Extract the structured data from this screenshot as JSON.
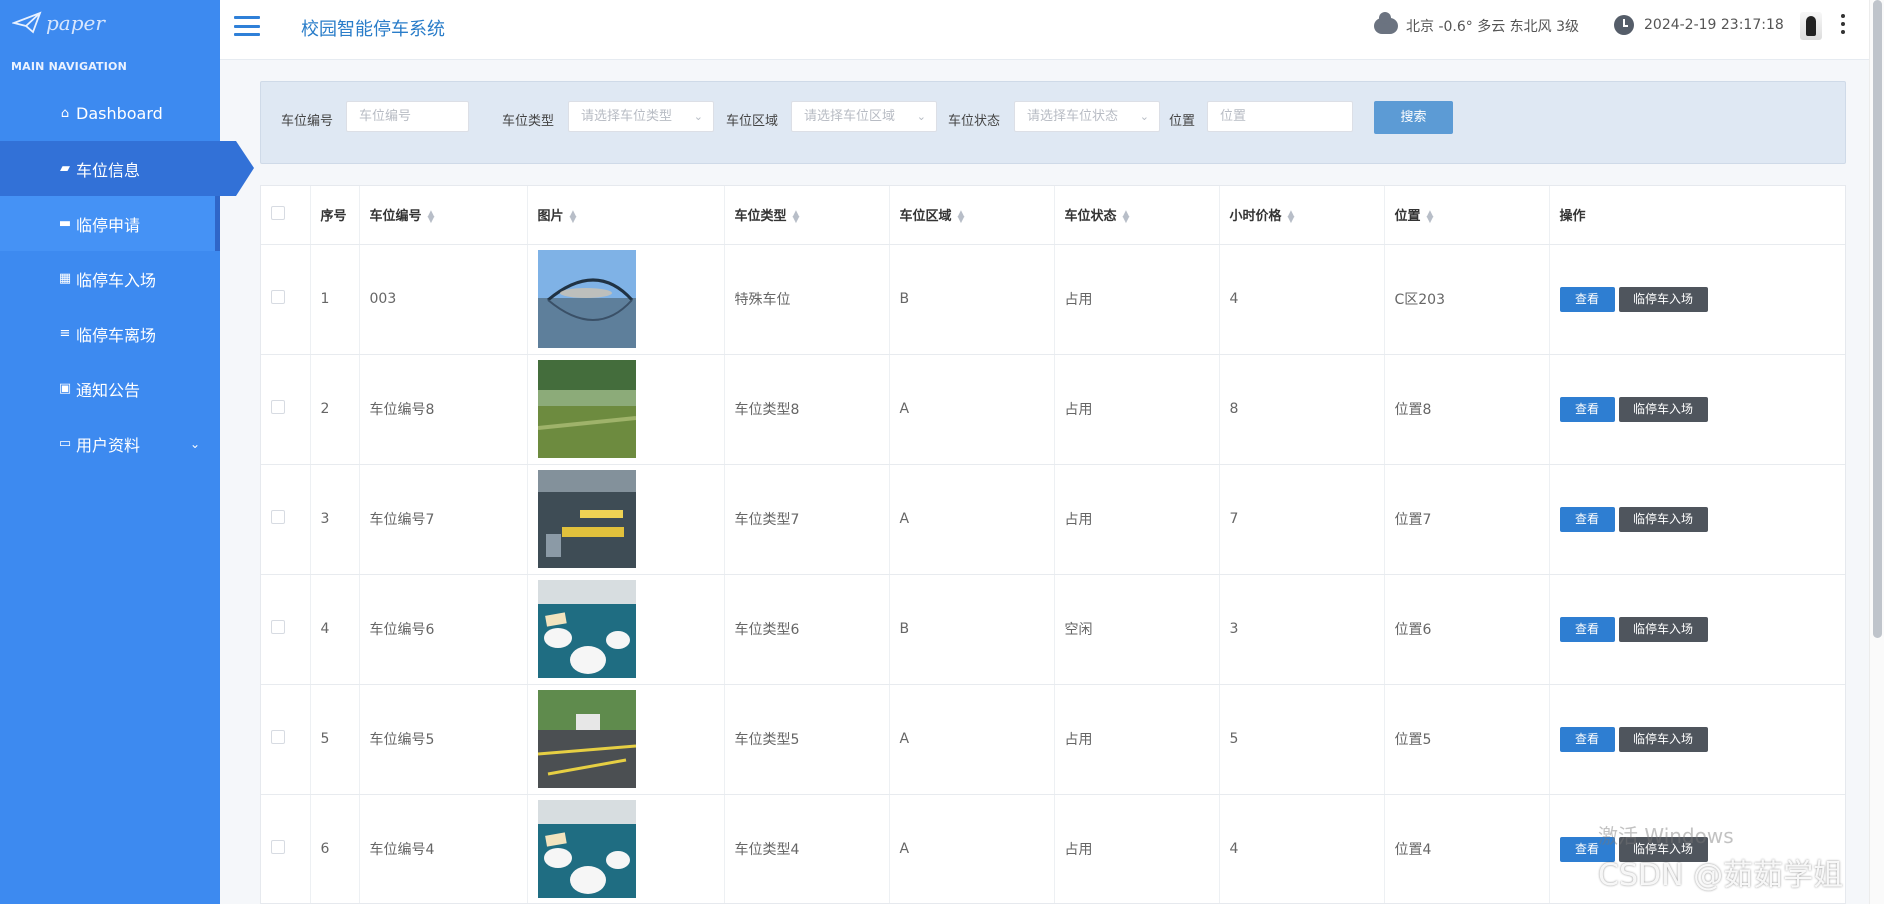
{
  "sidebar": {
    "logo_text": "paper",
    "nav_title": "MAIN NAVIGATION",
    "items": [
      {
        "label": "Dashboard"
      },
      {
        "label": "车位信息"
      },
      {
        "label": "临停申请"
      },
      {
        "label": "临停车入场"
      },
      {
        "label": "临停车离场"
      },
      {
        "label": "通知公告"
      },
      {
        "label": "用户资料"
      }
    ]
  },
  "header": {
    "title": "校园智能停车系统",
    "weather": "北京  -0.6°  多云  东北风  3级",
    "datetime": "2024-2-19 23:17:18"
  },
  "search": {
    "fields": [
      {
        "label": "车位编号",
        "placeholder": "车位编号"
      },
      {
        "label": "车位类型",
        "placeholder": "请选择车位类型"
      },
      {
        "label": "车位区域",
        "placeholder": "请选择车位区域"
      },
      {
        "label": "车位状态",
        "placeholder": "请选择车位状态"
      },
      {
        "label": "位置",
        "placeholder": "位置"
      }
    ],
    "button": "搜索"
  },
  "table": {
    "columns": [
      "序号",
      "车位编号",
      "图片",
      "车位类型",
      "车位区域",
      "车位状态",
      "小时价格",
      "位置",
      "操作"
    ],
    "rows": [
      {
        "index": "1",
        "code": "003",
        "type": "特殊车位",
        "area": "B",
        "status": "占用",
        "price": "4",
        "location": "C区203"
      },
      {
        "index": "2",
        "code": "车位编号8",
        "type": "车位类型8",
        "area": "A",
        "status": "占用",
        "price": "8",
        "location": "位置8"
      },
      {
        "index": "3",
        "code": "车位编号7",
        "type": "车位类型7",
        "area": "A",
        "status": "占用",
        "price": "7",
        "location": "位置7"
      },
      {
        "index": "4",
        "code": "车位编号6",
        "type": "车位类型6",
        "area": "B",
        "status": "空闲",
        "price": "3",
        "location": "位置6"
      },
      {
        "index": "5",
        "code": "车位编号5",
        "type": "车位类型5",
        "area": "A",
        "status": "占用",
        "price": "5",
        "location": "位置5"
      },
      {
        "index": "6",
        "code": "车位编号4",
        "type": "车位类型4",
        "area": "A",
        "status": "占用",
        "price": "4",
        "location": "位置4"
      }
    ],
    "actions": {
      "view": "查看",
      "enter": "临停车入场"
    }
  },
  "overlay": {
    "windows_text": "激活 Windows",
    "csdn_text": "CSDN @茹茹学姐"
  },
  "colors": {
    "sidebar": "#3d8af0",
    "header_title": "#2a7dc9",
    "view_button": "#2e7ed2",
    "enter_button": "#4f555d"
  }
}
